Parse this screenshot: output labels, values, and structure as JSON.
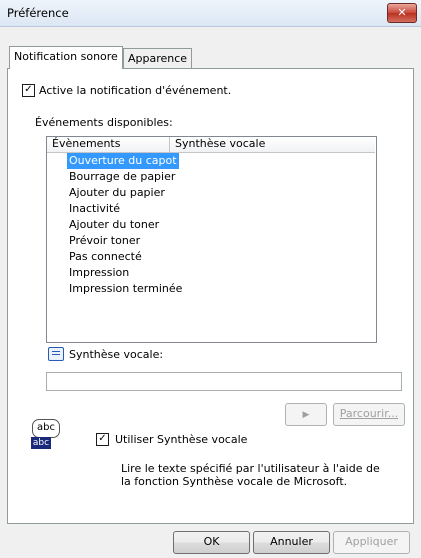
{
  "window": {
    "title": "Préférence",
    "close_glyph": "✕"
  },
  "tabs": [
    {
      "label": "Notification sonore",
      "active": true
    },
    {
      "label": "Apparence",
      "active": false
    }
  ],
  "notification": {
    "enable_label": "Active la notification d'événement.",
    "enable_checked": true,
    "available_label": "Événements disponibles:"
  },
  "events_list": {
    "columns": [
      "Évènements",
      "Synthèse vocale"
    ],
    "items": [
      "Ouverture du capot",
      "Bourrage de papier",
      "Ajouter du papier",
      "Inactivité",
      "Ajouter du toner",
      "Prévoir toner",
      "Pas connecté",
      "Impression",
      "Impression terminée"
    ],
    "selected_index": 0
  },
  "speech": {
    "label": "Synthèse vocale:",
    "value": "",
    "play_glyph": "▶",
    "browse_label": "Parcourir...",
    "use_label": "Utiliser Synthèse vocale",
    "use_checked": true,
    "abc_icon_text": "abc",
    "description": "Lire le texte spécifié par l'utilisateur à l'aide de la fonction Synthèse vocale de Microsoft."
  },
  "buttons": {
    "ok": "OK",
    "cancel": "Annuler",
    "apply": "Appliquer"
  },
  "colors": {
    "selection": "#3399ff",
    "close_button": "#c8453a"
  }
}
